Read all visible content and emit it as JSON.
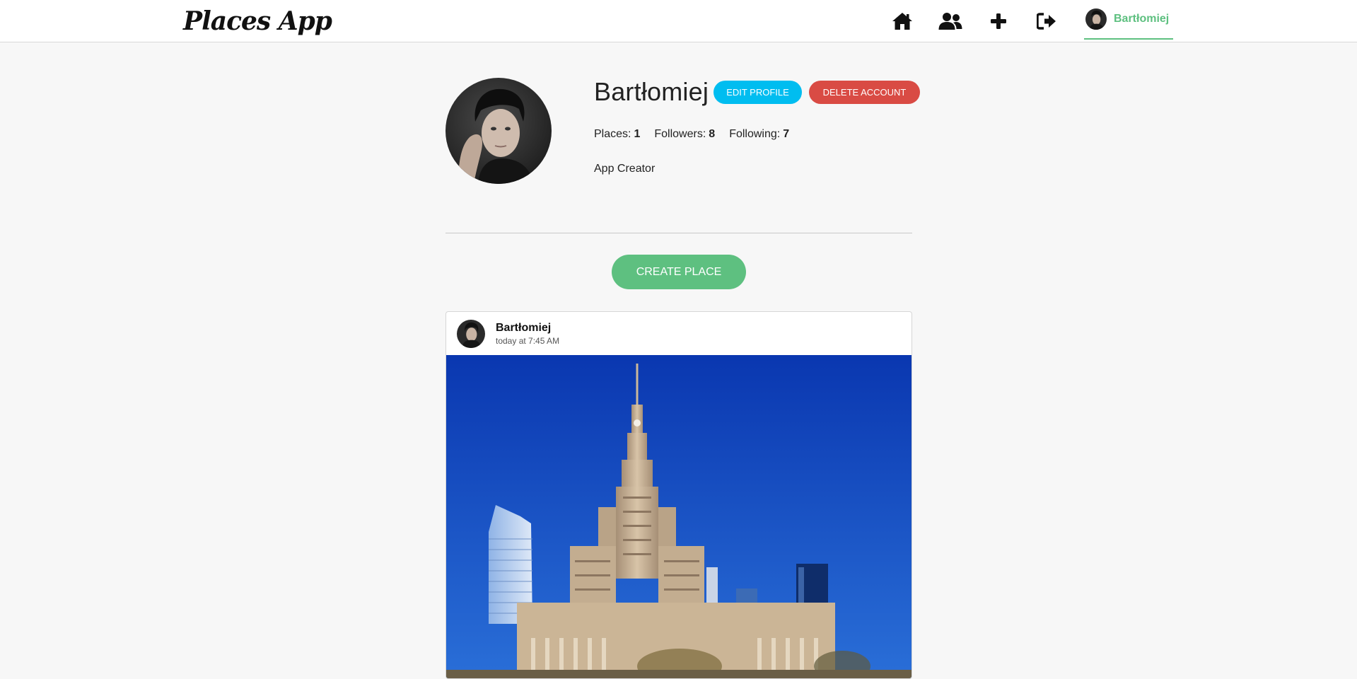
{
  "app": {
    "logo": "Places App"
  },
  "nav": {
    "icons": [
      "home-icon",
      "users-icon",
      "plus-icon",
      "sign-out-icon"
    ],
    "user_name": "Bartłomiej",
    "accent": "#5ec080"
  },
  "profile": {
    "name": "Bartłomiej",
    "edit_label": "EDIT PROFILE",
    "delete_label": "DELETE ACCOUNT",
    "stats": {
      "places_label": "Places:",
      "places_value": "1",
      "followers_label": "Followers:",
      "followers_value": "8",
      "following_label": "Following:",
      "following_value": "7"
    },
    "bio": "App Creator"
  },
  "actions": {
    "create_label": "CREATE PLACE"
  },
  "post": {
    "author": "Bartłomiej",
    "time": "today at 7:45 AM"
  },
  "colors": {
    "edit": "#00bdf0",
    "delete": "#d94b44",
    "create": "#5ec080",
    "background": "#f7f7f7"
  }
}
